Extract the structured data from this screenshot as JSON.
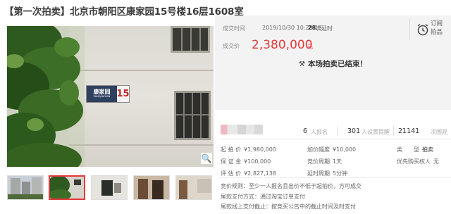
{
  "title": "【第一次拍卖】北京市朝阳区康家园15号楼16层1608室",
  "photo": {
    "sign_name": "康家园",
    "sign_sub": "KANGJIAYUAN",
    "sign_number": "15"
  },
  "thumbnails": [
    "thumb-1",
    "thumb-2",
    "thumb-3",
    "thumb-4",
    "thumb-5"
  ],
  "deal": {
    "time_label": "成交时间",
    "time_value": "2019/10/30 10:28:16",
    "bid_count": "28",
    "bid_suffix": "次延时",
    "price_label": "成交价",
    "price_value": "2,380,000",
    "price_unit": "元",
    "ended_text": "本场拍卖已结束！"
  },
  "subscribe": {
    "line1": "订阅",
    "line2": "拍品"
  },
  "stats": {
    "registrants": "6",
    "registrants_label": "人报名",
    "reminders": "301",
    "reminders_label": "人设置提醒",
    "views": "21141",
    "views_label": "次围观"
  },
  "info": {
    "start_price_label": "起 拍 价",
    "start_price_value": "¥1,980,000",
    "increment_label": "加价幅度",
    "increment_value": "¥10,000",
    "type_label": "类　　型",
    "type_value": "拍卖",
    "deposit_label": "保 证 金",
    "deposit_value": "¥100,000",
    "period_label": "竞价周期",
    "period_value": "1天",
    "priority_label": "优先购买权人",
    "priority_value": "无",
    "valuation_label": "评 估 价",
    "valuation_value": "¥2,827,138",
    "delay_label": "延时周期",
    "delay_value": "5分钟"
  },
  "rules": {
    "line1": "竞价规则：至少一人报名且出价不低于起拍价，方可成交",
    "line2": "尾款支付方式：通过淘宝订单支付",
    "line3": "尾款线上支付截止：按竞买公告中的截止时间及时支付"
  },
  "colors": {
    "accent": "#e4393c",
    "panel_bg": "#f3f3f3"
  }
}
